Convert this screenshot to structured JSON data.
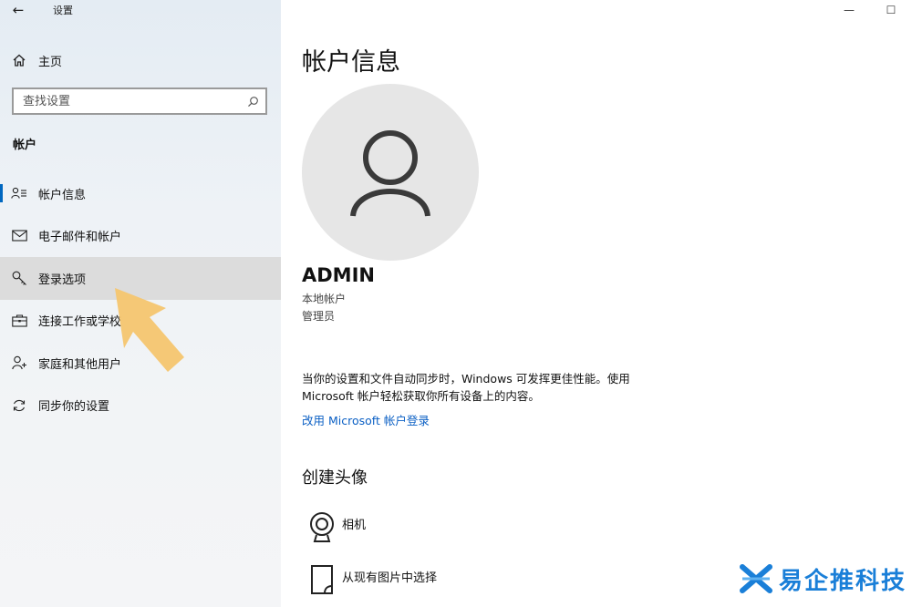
{
  "titlebar": {
    "app_title": "设置",
    "back_glyph": "←",
    "minimize_glyph": "—",
    "maximize_glyph": "☐"
  },
  "sidebar": {
    "home_label": "主页",
    "search_placeholder": "查找设置",
    "section_title": "帐户",
    "items": [
      {
        "label": "帐户信息",
        "icon": "account-info-icon"
      },
      {
        "label": "电子邮件和帐户",
        "icon": "mail-icon"
      },
      {
        "label": "登录选项",
        "icon": "key-icon"
      },
      {
        "label": "连接工作或学校",
        "icon": "briefcase-icon"
      },
      {
        "label": "家庭和其他用户",
        "icon": "add-user-icon"
      },
      {
        "label": "同步你的设置",
        "icon": "sync-icon"
      }
    ]
  },
  "main": {
    "title": "帐户信息",
    "user_name": "ADMIN",
    "account_type": "本地帐户",
    "role": "管理员",
    "description_line1": "当你的设置和文件自动同步时，Windows 可发挥更佳性能。使用",
    "description_line2": "Microsoft 帐户轻松获取你所有设备上的内容。",
    "link_label": "改用 Microsoft 帐户登录",
    "create_avatar_title": "创建头像",
    "options": [
      {
        "label": "相机",
        "icon": "camera-icon"
      },
      {
        "label": "从现有图片中选择",
        "icon": "picture-file-icon"
      }
    ]
  },
  "watermark": {
    "text": "易企推科技"
  },
  "colors": {
    "accent": "#0067c0",
    "link": "#0a5fc4",
    "arrow": "#f5c46a",
    "watermark": "#1a7fd8"
  }
}
